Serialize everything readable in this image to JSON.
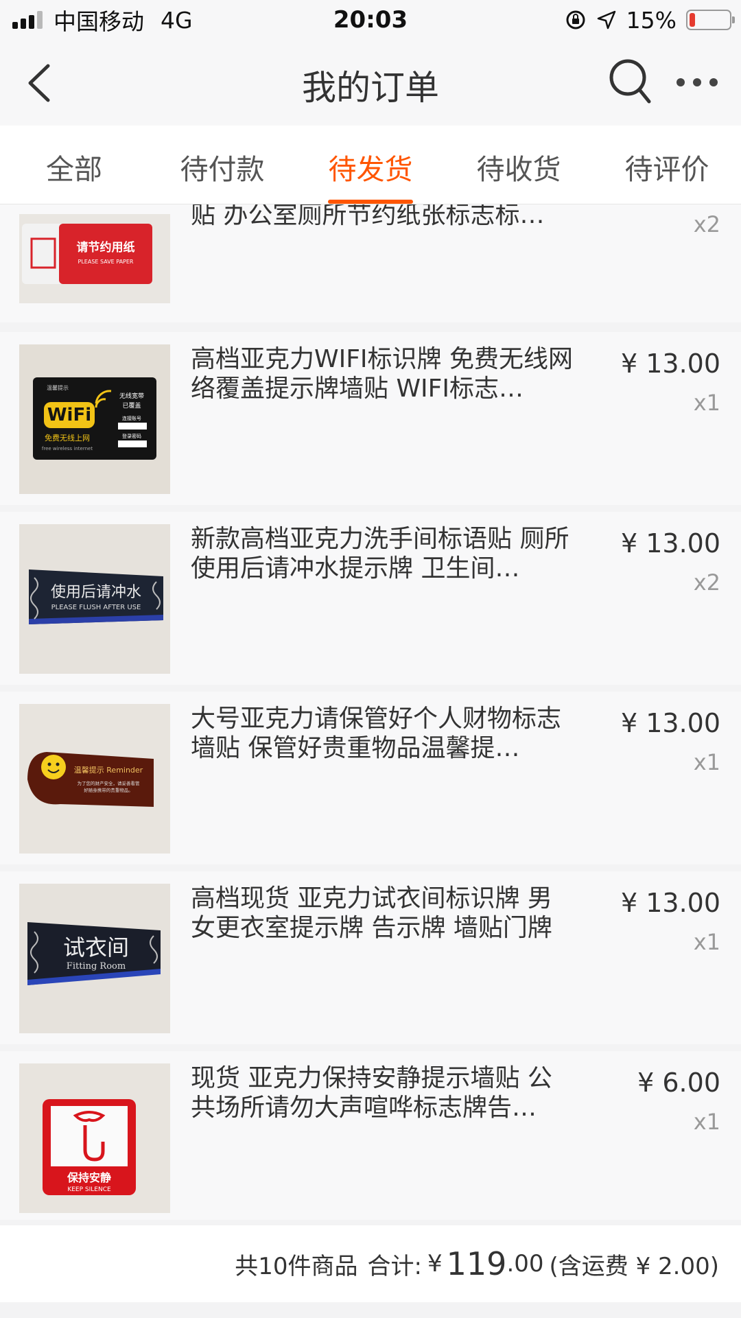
{
  "status_bar": {
    "carrier": "中国移动",
    "network": "4G",
    "time": "20:03",
    "battery": "15%",
    "battery_level": 0.15,
    "battery_color": "#e53b2f"
  },
  "nav": {
    "title": "我的订单",
    "icons": [
      "back-arrow-icon",
      "search-icon",
      "more-icon"
    ]
  },
  "tabs": [
    {
      "label": "全部",
      "active": false
    },
    {
      "label": "待付款",
      "active": false
    },
    {
      "label": "待发货",
      "active": true
    },
    {
      "label": "待收货",
      "active": false
    },
    {
      "label": "待评价",
      "active": false
    }
  ],
  "accent_color": "#ff5500",
  "items": [
    {
      "title": "贴 办公室厕所节约纸张标志标…",
      "price": "",
      "qty": "x2",
      "thumb": "save-paper-sign",
      "thumb_text": [
        "请节约用纸",
        "PLEASE SAVE PAPER"
      ]
    },
    {
      "title": "高档亚克力WIFI标识牌 免费无线网络覆盖提示牌墙贴 WIFI标志…",
      "price": "¥ 13.00",
      "qty": "x1",
      "thumb": "wifi-sign",
      "thumb_text": [
        "WiFi",
        "免费无线上网",
        "free wireless internet",
        "无线宽带",
        "已覆盖",
        "连接账号",
        "登录密码",
        "温馨提示"
      ]
    },
    {
      "title": "新款高档亚克力洗手间标语贴 厕所使用后请冲水提示牌 卫生间…",
      "price": "¥ 13.00",
      "qty": "x2",
      "thumb": "flush-sign",
      "thumb_text": [
        "使用后请冲水",
        "PLEASE FLUSH AFTER USE"
      ]
    },
    {
      "title": "大号亚克力请保管好个人财物标志墙贴 保管好贵重物品温馨提…",
      "price": "¥ 13.00",
      "qty": "x1",
      "thumb": "reminder-sign",
      "thumb_text": [
        "温馨提示 Reminder",
        "为了您的财产安全，请妥善看管",
        "好随身携带的贵重物品。"
      ]
    },
    {
      "title": "高档现货 亚克力试衣间标识牌 男女更衣室提示牌 告示牌 墙贴门牌",
      "price": "¥ 13.00",
      "qty": "x1",
      "thumb": "fitting-room-sign",
      "thumb_text": [
        "试衣间",
        "Fitting Room"
      ]
    },
    {
      "title": "现货 亚克力保持安静提示墙贴 公共场所请勿大声喧哗标志牌告…",
      "price": "¥ 6.00",
      "qty": "x1",
      "thumb": "keep-silence-sign",
      "thumb_text": [
        "保持安静",
        "KEEP SILENCE"
      ]
    }
  ],
  "summary": {
    "count_text": "共10件商品",
    "total_label": "合计:",
    "currency": "¥",
    "total_int": "119",
    "total_dec": ".00",
    "shipping_text": "(含运费 ¥ 2.00)"
  }
}
